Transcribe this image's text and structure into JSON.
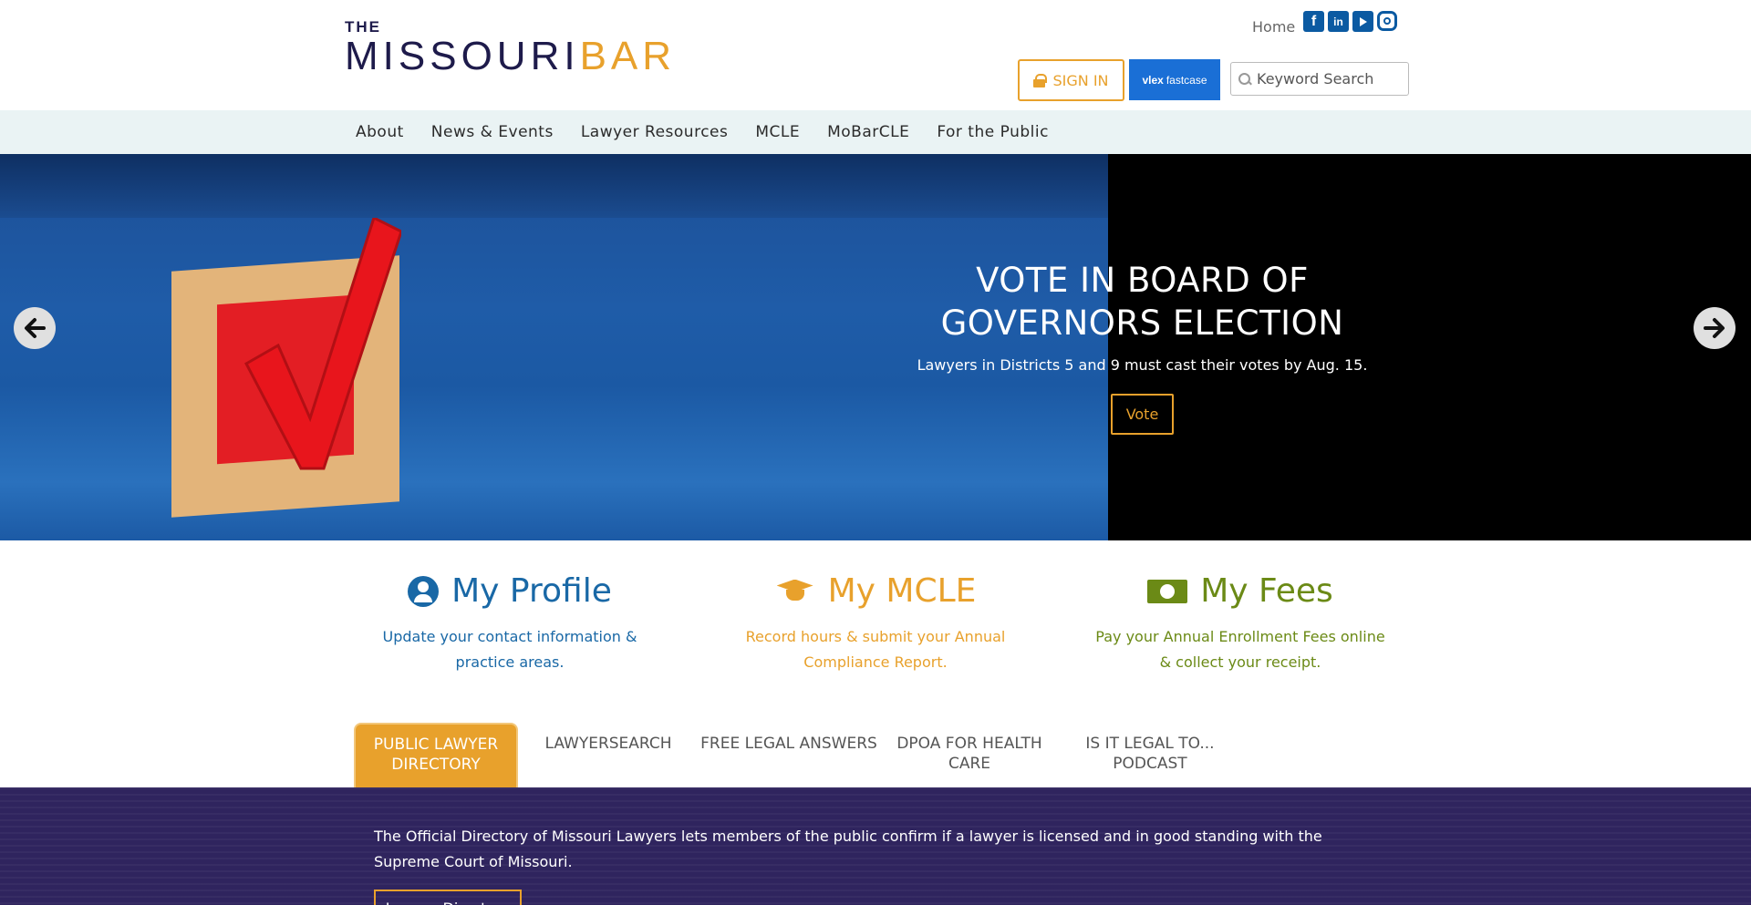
{
  "logo": {
    "the": "THE",
    "missouri": "MISSOURI",
    "bar": "BAR"
  },
  "header": {
    "home": "Home",
    "social": {
      "facebook": "f",
      "linkedin": "in"
    },
    "signin": "SIGN IN",
    "vlex": {
      "a": "vlex",
      "b": "fastcase"
    },
    "search_placeholder": "Keyword Search"
  },
  "nav": [
    "About",
    "News & Events",
    "Lawyer Resources",
    "MCLE",
    "MoBarCLE",
    "For the Public"
  ],
  "hero": {
    "title": "VOTE IN BOARD OF GOVERNORS ELECTION",
    "subtitle": "Lawyers in Districts 5 and 9 must cast their votes by Aug. 15.",
    "button": "Vote"
  },
  "quick": [
    {
      "title": "My Profile",
      "text": "Update your contact information & practice areas."
    },
    {
      "title": "My MCLE",
      "text": "Record hours & submit your Annual Compliance Report."
    },
    {
      "title": "My Fees",
      "text": "Pay your Annual Enrollment Fees online & collect your receipt."
    }
  ],
  "tabs": [
    "PUBLIC LAWYER DIRECTORY",
    "LAWYERSEARCH",
    "FREE LEGAL ANSWERS",
    "DPOA FOR HEALTH CARE",
    "IS IT LEGAL TO... PODCAST"
  ],
  "panel": {
    "text": "The Official Directory of Missouri Lawyers lets members of the public confirm if a lawyer is licensed and in good standing with the Supreme Court of Missouri.",
    "button": "Lawyer Directory"
  },
  "colors": {
    "accent": "#e8a12c",
    "navy": "#1e1b4b",
    "profile": "#1968a6",
    "fees": "#6b8a16",
    "panel": "#2f245e"
  }
}
